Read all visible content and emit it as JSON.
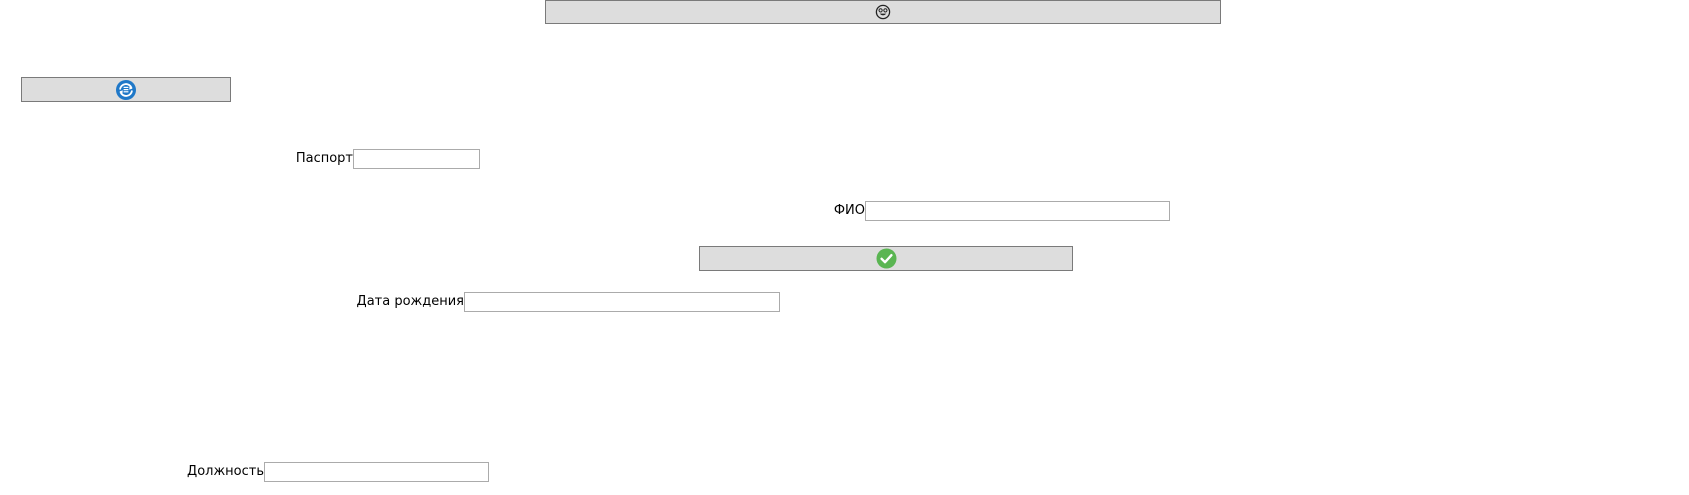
{
  "buttons": {
    "top": {
      "icon": "face-icon"
    },
    "reload": {
      "icon": "refresh-icon"
    },
    "confirm": {
      "icon": "checkmark-icon"
    }
  },
  "form": {
    "passport": {
      "label": "Паспорт",
      "value": ""
    },
    "fio": {
      "label": "ФИО",
      "value": ""
    },
    "birth_date": {
      "label": "Дата рождения",
      "value": ""
    },
    "position": {
      "label": "Должность",
      "value": ""
    }
  },
  "colors": {
    "button_bg": "#dddddd",
    "button_border": "#7a7a7a",
    "field_border": "#ababab",
    "refresh_icon": "#1f78c8",
    "check_icon": "#5ab552"
  }
}
